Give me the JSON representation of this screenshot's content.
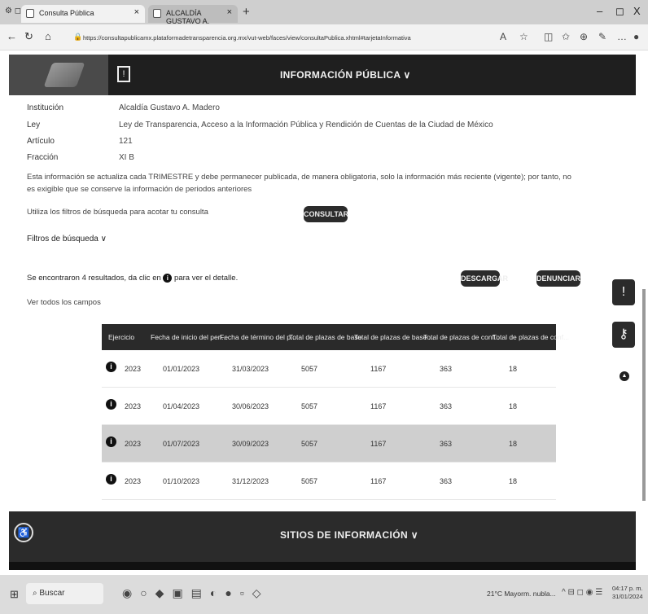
{
  "browser": {
    "tabs": [
      {
        "label": "Consulta Pública"
      },
      {
        "label": "ALCALDÍA GUSTAVO A. MADERO"
      }
    ],
    "url": "https://consultapublicamx.plataformadetransparencia.org.mx/vut-web/faces/view/consultaPublica.xhtml#tarjetaInformativa",
    "window_minimize": "–",
    "window_restore": "◻",
    "window_close": "X"
  },
  "header": {
    "title": "INFORMACIÓN PÚBLICA ∨"
  },
  "metadata": {
    "institucion_label": "Institución",
    "institucion_value": "Alcaldía Gustavo A. Madero",
    "ley_label": "Ley",
    "ley_value": "Ley de Transparencia, Acceso a la Información Pública y Rendición de Cuentas de la Ciudad de México",
    "articulo_label": "Artículo",
    "articulo_value": "121",
    "fraccion_label": "Fracción",
    "fraccion_value": "XI B",
    "notice": "Esta información se actualiza cada TRIMESTRE y debe permanecer publicada, de manera obligatoria, solo la información más reciente (vigente); por tanto, no es exigible que se conserve la información de periodos anteriores"
  },
  "search": {
    "hint": "Utiliza los filtros de búsqueda para acotar tu consulta",
    "consultar_label": "CONSULTAR",
    "filters_label": "Filtros de búsqueda ∨"
  },
  "results": {
    "summary_before": "Se encontraron 4 resultados, da clic en",
    "summary_after": "para ver el detalle.",
    "see_all": "Ver todos los campos",
    "descargar_label": "DESCARGAR",
    "denunciar_label": "DENUNCIAR"
  },
  "table": {
    "headers": [
      "Ejercicio",
      "Fecha de inicio del peri...",
      "Fecha de término del p...",
      "Total de plazas de base",
      "Total de plazas de base ...",
      "Total de plazas de conf...",
      "Total de plazas de conf..."
    ],
    "rows": [
      [
        "2023",
        "01/01/2023",
        "31/03/2023",
        "5057",
        "1167",
        "363",
        "18"
      ],
      [
        "2023",
        "01/04/2023",
        "30/06/2023",
        "5057",
        "1167",
        "363",
        "18"
      ],
      [
        "2023",
        "01/07/2023",
        "30/09/2023",
        "5057",
        "1167",
        "363",
        "18"
      ],
      [
        "2023",
        "01/10/2023",
        "31/12/2023",
        "5057",
        "1167",
        "363",
        "18"
      ]
    ]
  },
  "footer": {
    "title": "SITIOS DE INFORMACIÓN ∨"
  },
  "taskbar": {
    "search_label": "Buscar",
    "weather": "21°C  Mayorm. nubla...",
    "time": "04:17 p. m.",
    "date": "31/01/2024"
  }
}
